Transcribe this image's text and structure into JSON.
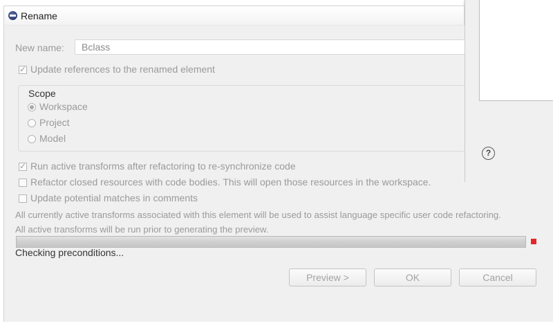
{
  "title": "Rename",
  "new_name": {
    "label": "New name:",
    "value": "Bclass"
  },
  "update_references": {
    "label": "Update references to the renamed element",
    "checked": true
  },
  "scope": {
    "label": "Scope",
    "options": [
      {
        "label": "Workspace",
        "selected": true
      },
      {
        "label": "Project",
        "selected": false
      },
      {
        "label": "Model",
        "selected": false
      }
    ]
  },
  "options": [
    {
      "label": "Run active transforms after refactoring to re-synchronize code",
      "checked": true
    },
    {
      "label": "Refactor closed resources with code bodies. This will open those resources in the workspace.",
      "checked": false
    },
    {
      "label": "Update potential matches in comments",
      "checked": false
    }
  ],
  "info_lines": [
    "All currently active transforms associated with this element will be used to assist language specific user code refactoring.",
    "All active transforms will be run prior to generating the preview."
  ],
  "status": "Checking preconditions...",
  "buttons": {
    "preview": "Preview >",
    "ok": "OK",
    "cancel": "Cancel"
  },
  "help_icon": "?",
  "colors": {
    "stop": "#e3262b"
  }
}
